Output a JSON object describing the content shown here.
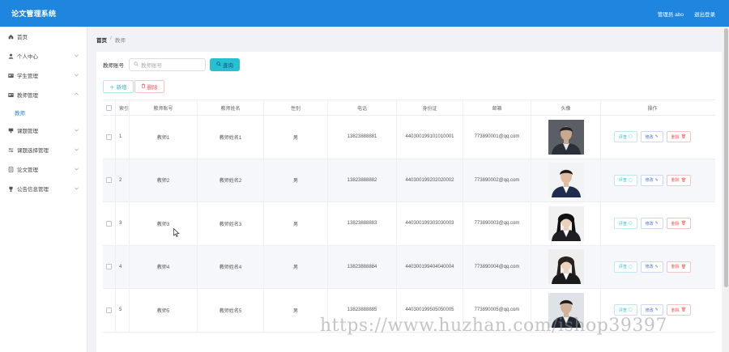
{
  "header": {
    "title": "论文管理系统",
    "user_label": "管理员 abo",
    "logout_label": "退出登录",
    "bg_color": "#1f86e0"
  },
  "sidebar": {
    "items": [
      {
        "label": "首页",
        "icon": "home-icon",
        "has_chevron": false
      },
      {
        "label": "个人中心",
        "icon": "user-icon",
        "has_chevron": true
      },
      {
        "label": "学生管理",
        "icon": "id-card-icon",
        "has_chevron": true
      },
      {
        "label": "教师管理",
        "icon": "id-card-icon",
        "has_chevron": true,
        "expanded": true
      },
      {
        "label": "课题管理",
        "icon": "flag-icon",
        "has_chevron": true
      },
      {
        "label": "课题选择管理",
        "icon": "sliders-icon",
        "has_chevron": true
      },
      {
        "label": "论文管理",
        "icon": "document-icon",
        "has_chevron": true
      },
      {
        "label": "公告信息管理",
        "icon": "trophy-icon",
        "has_chevron": true
      }
    ],
    "sub_item": "教师"
  },
  "breadcrumb": {
    "home": "首页",
    "separator": "/",
    "current": "教师"
  },
  "search": {
    "label": "教师账号",
    "placeholder": "教师账号",
    "button_label": "查询"
  },
  "actions": {
    "add_label": "新增",
    "delete_label": "删除"
  },
  "table": {
    "columns": [
      "索引",
      "教师账号",
      "教师姓名",
      "性别",
      "电话",
      "身份证",
      "邮箱",
      "头像",
      "操作"
    ],
    "rows": [
      {
        "index": "1",
        "account": "教师1",
        "name": "教师姓名1",
        "sex": "男",
        "phone": "13823888881",
        "id_card": "440300199101010001",
        "email": "773890001@qq.com"
      },
      {
        "index": "2",
        "account": "教师2",
        "name": "教师姓名2",
        "sex": "男",
        "phone": "13823888882",
        "id_card": "440300199202020002",
        "email": "773890002@qq.com"
      },
      {
        "index": "3",
        "account": "教师3",
        "name": "教师姓名3",
        "sex": "男",
        "phone": "13823888883",
        "id_card": "440300199303030003",
        "email": "773890003@qq.com"
      },
      {
        "index": "4",
        "account": "教师4",
        "name": "教师姓名4",
        "sex": "男",
        "phone": "13823888884",
        "id_card": "440300199404040004",
        "email": "773890004@qq.com"
      },
      {
        "index": "5",
        "account": "教师5",
        "name": "教师姓名5",
        "sex": "男",
        "phone": "13823888885",
        "id_card": "440300199505050005",
        "email": "773890005@qq.com"
      }
    ],
    "row_actions": {
      "review": "评查",
      "edit": "修改",
      "delete": "删除"
    }
  },
  "watermark": "https://www.huzhan.com/ishop39397"
}
